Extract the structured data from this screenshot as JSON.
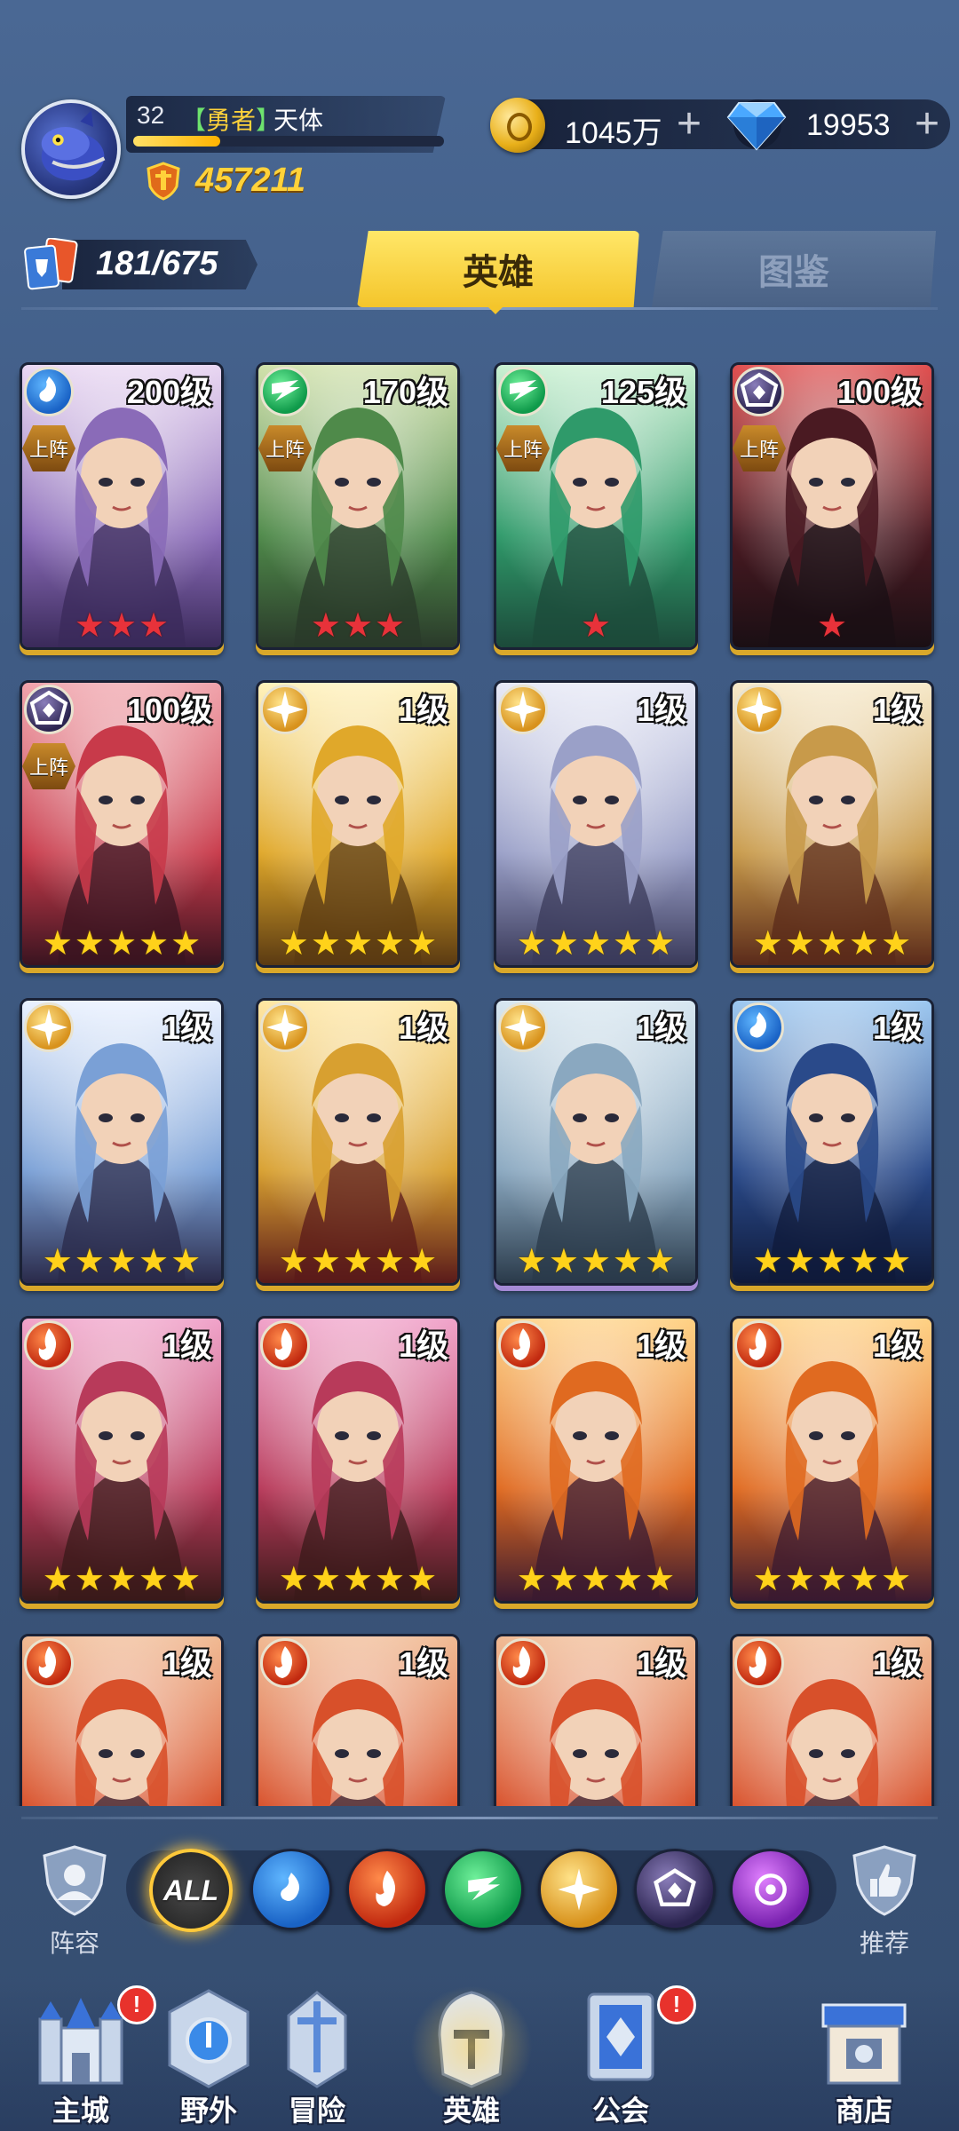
{
  "player": {
    "level": "32",
    "rank_open": "【",
    "rank": "勇者",
    "rank_close": "】",
    "name": "天体",
    "exp_fraction": 0.28,
    "power": "457211"
  },
  "resources": {
    "gold": "1045万",
    "gems": "19953",
    "plus": "+"
  },
  "hero_count": "181/675",
  "tabs": {
    "heroes": "英雄",
    "atlas": "图鉴"
  },
  "deploy_label": "上阵",
  "heroes": [
    {
      "level": "200级",
      "element": "water",
      "deployed": true,
      "stars": 3,
      "star_color": "red",
      "palette": [
        "#e9d6f2",
        "#8a6bb8",
        "#3a2a5a"
      ]
    },
    {
      "level": "170级",
      "element": "wind",
      "deployed": true,
      "stars": 3,
      "star_color": "red",
      "palette": [
        "#cfe0a8",
        "#4f8a4a",
        "#2a3a2a"
      ]
    },
    {
      "level": "125级",
      "element": "wind",
      "deployed": true,
      "stars": 1,
      "star_color": "red",
      "palette": [
        "#c8f0d0",
        "#2f9a6a",
        "#1c4a3a"
      ]
    },
    {
      "level": "100级",
      "element": "dark",
      "deployed": true,
      "stars": 1,
      "star_color": "red",
      "palette": [
        "#e04a4a",
        "#4a1a22",
        "#1a0f14"
      ]
    },
    {
      "level": "100级",
      "element": "dark",
      "deployed": true,
      "stars": 5,
      "star_color": "gold",
      "palette": [
        "#f0a0a8",
        "#c83a4a",
        "#3a1420"
      ]
    },
    {
      "level": "1级",
      "element": "light",
      "deployed": false,
      "stars": 5,
      "star_color": "gold",
      "palette": [
        "#fff1b8",
        "#e0a82a",
        "#5a3a12"
      ]
    },
    {
      "level": "1级",
      "element": "light",
      "deployed": false,
      "stars": 5,
      "star_color": "gold",
      "palette": [
        "#e6e8f6",
        "#9aa0c8",
        "#3a3a5a"
      ]
    },
    {
      "level": "1级",
      "element": "light",
      "deployed": false,
      "stars": 5,
      "star_color": "gold",
      "palette": [
        "#f6e8c8",
        "#c89a4a",
        "#5a2a1a"
      ]
    },
    {
      "level": "1级",
      "element": "light",
      "deployed": false,
      "stars": 5,
      "star_color": "gold",
      "palette": [
        "#e8f0ff",
        "#7aa0d6",
        "#2a2a4a"
      ]
    },
    {
      "level": "1级",
      "element": "light",
      "deployed": false,
      "stars": 5,
      "star_color": "gold",
      "palette": [
        "#ffe6a0",
        "#d8a030",
        "#5a1a1a"
      ]
    },
    {
      "level": "1级",
      "element": "light",
      "deployed": false,
      "stars": 5,
      "star_color": "gold",
      "palette": [
        "#d6e6f0",
        "#8aa8c0",
        "#2a3a4a"
      ],
      "frame": "purple"
    },
    {
      "level": "1级",
      "element": "water",
      "deployed": false,
      "stars": 5,
      "star_color": "gold",
      "palette": [
        "#9ac6f0",
        "#2a4a8a",
        "#0f1a3a"
      ]
    },
    {
      "level": "1级",
      "element": "fire",
      "deployed": false,
      "stars": 5,
      "star_color": "gold",
      "palette": [
        "#f0a0c8",
        "#b83a5a",
        "#3a1a1a"
      ]
    },
    {
      "level": "1级",
      "element": "fire",
      "deployed": false,
      "stars": 5,
      "star_color": "gold",
      "palette": [
        "#f0a0c8",
        "#b83a5a",
        "#3a1a1a"
      ]
    },
    {
      "level": "1级",
      "element": "fire",
      "deployed": false,
      "stars": 5,
      "star_color": "gold",
      "palette": [
        "#ffd080",
        "#e06a20",
        "#3a1a30"
      ]
    },
    {
      "level": "1级",
      "element": "fire",
      "deployed": false,
      "stars": 5,
      "star_color": "gold",
      "palette": [
        "#ffd080",
        "#e06a20",
        "#3a1a30"
      ]
    },
    {
      "level": "1级",
      "element": "fire",
      "deployed": false,
      "stars": 0,
      "star_color": "gold",
      "palette": [
        "#f0b890",
        "#d8502a",
        "#3a2a3a"
      ]
    },
    {
      "level": "1级",
      "element": "fire",
      "deployed": false,
      "stars": 0,
      "star_color": "gold",
      "palette": [
        "#f0b890",
        "#d8502a",
        "#3a2a3a"
      ]
    },
    {
      "level": "1级",
      "element": "fire",
      "deployed": false,
      "stars": 0,
      "star_color": "gold",
      "palette": [
        "#f0b890",
        "#d8502a",
        "#3a2a3a"
      ]
    },
    {
      "level": "1级",
      "element": "fire",
      "deployed": false,
      "stars": 0,
      "star_color": "gold",
      "palette": [
        "#f0b890",
        "#d8502a",
        "#3a2a3a"
      ]
    }
  ],
  "filter": {
    "lineup": "阵容",
    "recommend": "推荐",
    "all_label": "ALL",
    "elements": [
      "water",
      "fire",
      "wind",
      "light",
      "dark",
      "arcane"
    ],
    "selected": "ALL"
  },
  "nav": [
    {
      "id": "city",
      "label": "主城",
      "badge": "!"
    },
    {
      "id": "wild",
      "label": "野外",
      "badge": ""
    },
    {
      "id": "adventure",
      "label": "冒险",
      "badge": ""
    },
    {
      "id": "heroes",
      "label": "英雄",
      "badge": "",
      "active": true
    },
    {
      "id": "guild",
      "label": "公会",
      "badge": "!"
    },
    {
      "id": "shop",
      "label": "商店",
      "badge": ""
    }
  ]
}
